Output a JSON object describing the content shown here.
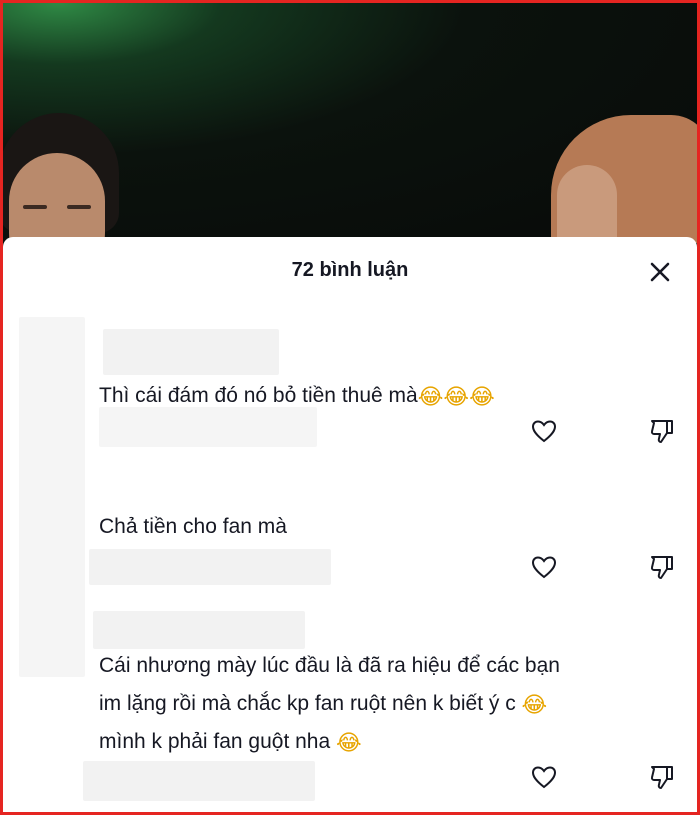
{
  "video": {
    "description_hidden": true
  },
  "comments_sheet": {
    "title": "72 bình luận",
    "close_icon": "close-icon"
  },
  "comments": [
    {
      "text": "Thì cái đám đó nó bỏ tiền thuê mà",
      "emoji": "😂😂😂",
      "like_icon": "heart-outline-icon",
      "dislike_icon": "thumbs-down-outline-icon"
    },
    {
      "text": "Chả tiền cho fan mà",
      "like_icon": "heart-outline-icon",
      "dislike_icon": "thumbs-down-outline-icon"
    },
    {
      "lines": [
        "Cái nhương mày lúc đầu là đã ra hiệu để các bạn",
        "im lặng rồi mà chắc kp fan ruột nên k biết ý c",
        "mình k phải fan guột nha"
      ],
      "line2_emoji": "😂",
      "line3_emoji": "😂",
      "like_icon": "heart-outline-icon",
      "dislike_icon": "thumbs-down-outline-icon"
    }
  ],
  "colors": {
    "frame_border": "#e52521",
    "text": "#161823",
    "icon": "#161823"
  }
}
